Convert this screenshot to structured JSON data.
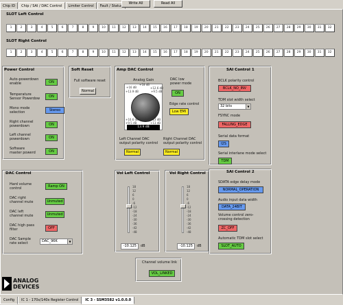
{
  "tabs": [
    {
      "label": "Chip ID"
    },
    {
      "label": "Chip / SAI / DAC Control",
      "active": true
    },
    {
      "label": "Limiter Control"
    },
    {
      "label": "Fault / Status"
    }
  ],
  "top_buttons": {
    "write_all": "Write All",
    "read_all": "Read All"
  },
  "slot_left": {
    "title": "SLOT Left Control",
    "slots": [
      "1",
      "2",
      "3",
      "4",
      "5",
      "6",
      "7",
      "8",
      "9",
      "10",
      "11",
      "12",
      "13",
      "14",
      "15",
      "16",
      "17",
      "18",
      "19",
      "20",
      "21",
      "22",
      "23",
      "24",
      "25",
      "26",
      "27",
      "28",
      "29",
      "30",
      "31",
      "32"
    ]
  },
  "slot_right": {
    "title": "SLOT Right Control",
    "slots": [
      "1",
      "2",
      "3",
      "4",
      "5",
      "6",
      "7",
      "8",
      "9",
      "10",
      "11",
      "12",
      "13",
      "14",
      "15",
      "16",
      "17",
      "18",
      "19",
      "20",
      "21",
      "22",
      "23",
      "24",
      "25",
      "26",
      "27",
      "28",
      "29",
      "30",
      "31",
      "32"
    ]
  },
  "power": {
    "title": "Power Control",
    "rows": [
      {
        "label": "Auto-powerdown\nenable",
        "value": "ON"
      },
      {
        "label": "Temperature\nSensor Powerdow",
        "value": "ON"
      },
      {
        "label": "Mono mode\nselection",
        "value": "Stereo"
      },
      {
        "label": "Right channel\npowerdown",
        "value": "ON"
      },
      {
        "label": "Left channel\npowerdown",
        "value": "ON"
      },
      {
        "label": "Software\nmaster powerd",
        "value": "ON"
      }
    ]
  },
  "soft_reset": {
    "title": "Soft Reset",
    "label": "Full software reset",
    "button": "Normal"
  },
  "amp_dac": {
    "title": "Amp DAC Control",
    "gain_label": "Analog Gain",
    "gain_ticks": [
      "+16 dB",
      "+18 dB",
      "+12.6 dB",
      "+13.9 dB",
      "+9.5 dB",
      "+16.6 dB",
      "+13 dB",
      "+9.5 dB",
      "+13 dB"
    ],
    "gain_value": "13.9 dB",
    "lowpower_label": "DAC low\npower mode",
    "lowpower_value": "ON",
    "edge_label": "Edge rate control",
    "edge_value": "Low EMI",
    "left_pol_label": "Left Channel DAC\noutput polarity control",
    "left_pol_value": "Normal",
    "right_pol_label": "Right Channel DAC\noutput polarity control",
    "right_pol_value": "Normal"
  },
  "sai1": {
    "title": "SAI Control 1",
    "bclk_label": "BCLK polarity control",
    "bclk_value": "BCLK_NO_INV",
    "tdm_label": "TDM slot width select",
    "tdm_value": "32 bits",
    "fsync_label": "FSYNC mode",
    "fsync_value": "FALLING_EDGE",
    "serial_label": "Serial data format",
    "serial_value": "I2S",
    "interleave_label": "Serial interlane mode select",
    "interleave_value": "TDM"
  },
  "dac": {
    "title": "DAC Control",
    "rows": [
      {
        "label": "Hard volume\ncontrol",
        "value": "Ramp ON"
      },
      {
        "label": "DAC right\nchannel mute",
        "value": "Unmuted"
      },
      {
        "label": "DAC left\nchannel mute",
        "value": "Unmuted"
      },
      {
        "label": "DAC high pass\nfilter",
        "value": "OFF"
      }
    ],
    "sample_label": "DAC Sample\nrate select",
    "sample_value": "DAC_96K"
  },
  "vol_left": {
    "title": "Vol Left Control",
    "ticks": [
      "18",
      "12",
      "6",
      "0",
      "-6",
      "-12",
      "-18",
      "-24",
      "-30",
      "-36",
      "-42",
      "-48"
    ],
    "value": "-10.125",
    "unit": "dB",
    "level_db": -10.125
  },
  "vol_right": {
    "title": "Vol Right Control",
    "ticks": [
      "18",
      "12",
      "6",
      "0",
      "-6",
      "-12",
      "-18",
      "-24",
      "-30",
      "-36",
      "-42",
      "-48"
    ],
    "value": "-10.125",
    "unit": "dB",
    "level_db": -10.125
  },
  "chan_link": {
    "label": "Channel volume link",
    "value": "VOL_LINKED"
  },
  "sai2": {
    "title": "SAI Control 2",
    "sdata_label": "SDATA edge delay mode",
    "sdata_value": "NORMAL_OPERATION",
    "width_label": "Audio input data width",
    "width_value": "DATA_24BIT",
    "zero_label": "Volume control zero-\ncrossing detection",
    "zero_value": "ZC_OFF",
    "auto_label": "Automatic TDM slot select",
    "auto_value": "SLOT_AUTO"
  },
  "logo": {
    "text": "ANALOG\nDEVICES"
  },
  "bottom_tabs": [
    {
      "label": "Config"
    },
    {
      "label": "IC 1 - 170x/140x Register Control"
    },
    {
      "label": "IC 3 - SSM3582 v1.0.0.0",
      "active": true
    }
  ],
  "colors": {
    "on": "#66cc44",
    "off": "#ee6666",
    "blue": "#6699ee",
    "yellow": "#ffee22",
    "bg": "#d4d0c8"
  }
}
